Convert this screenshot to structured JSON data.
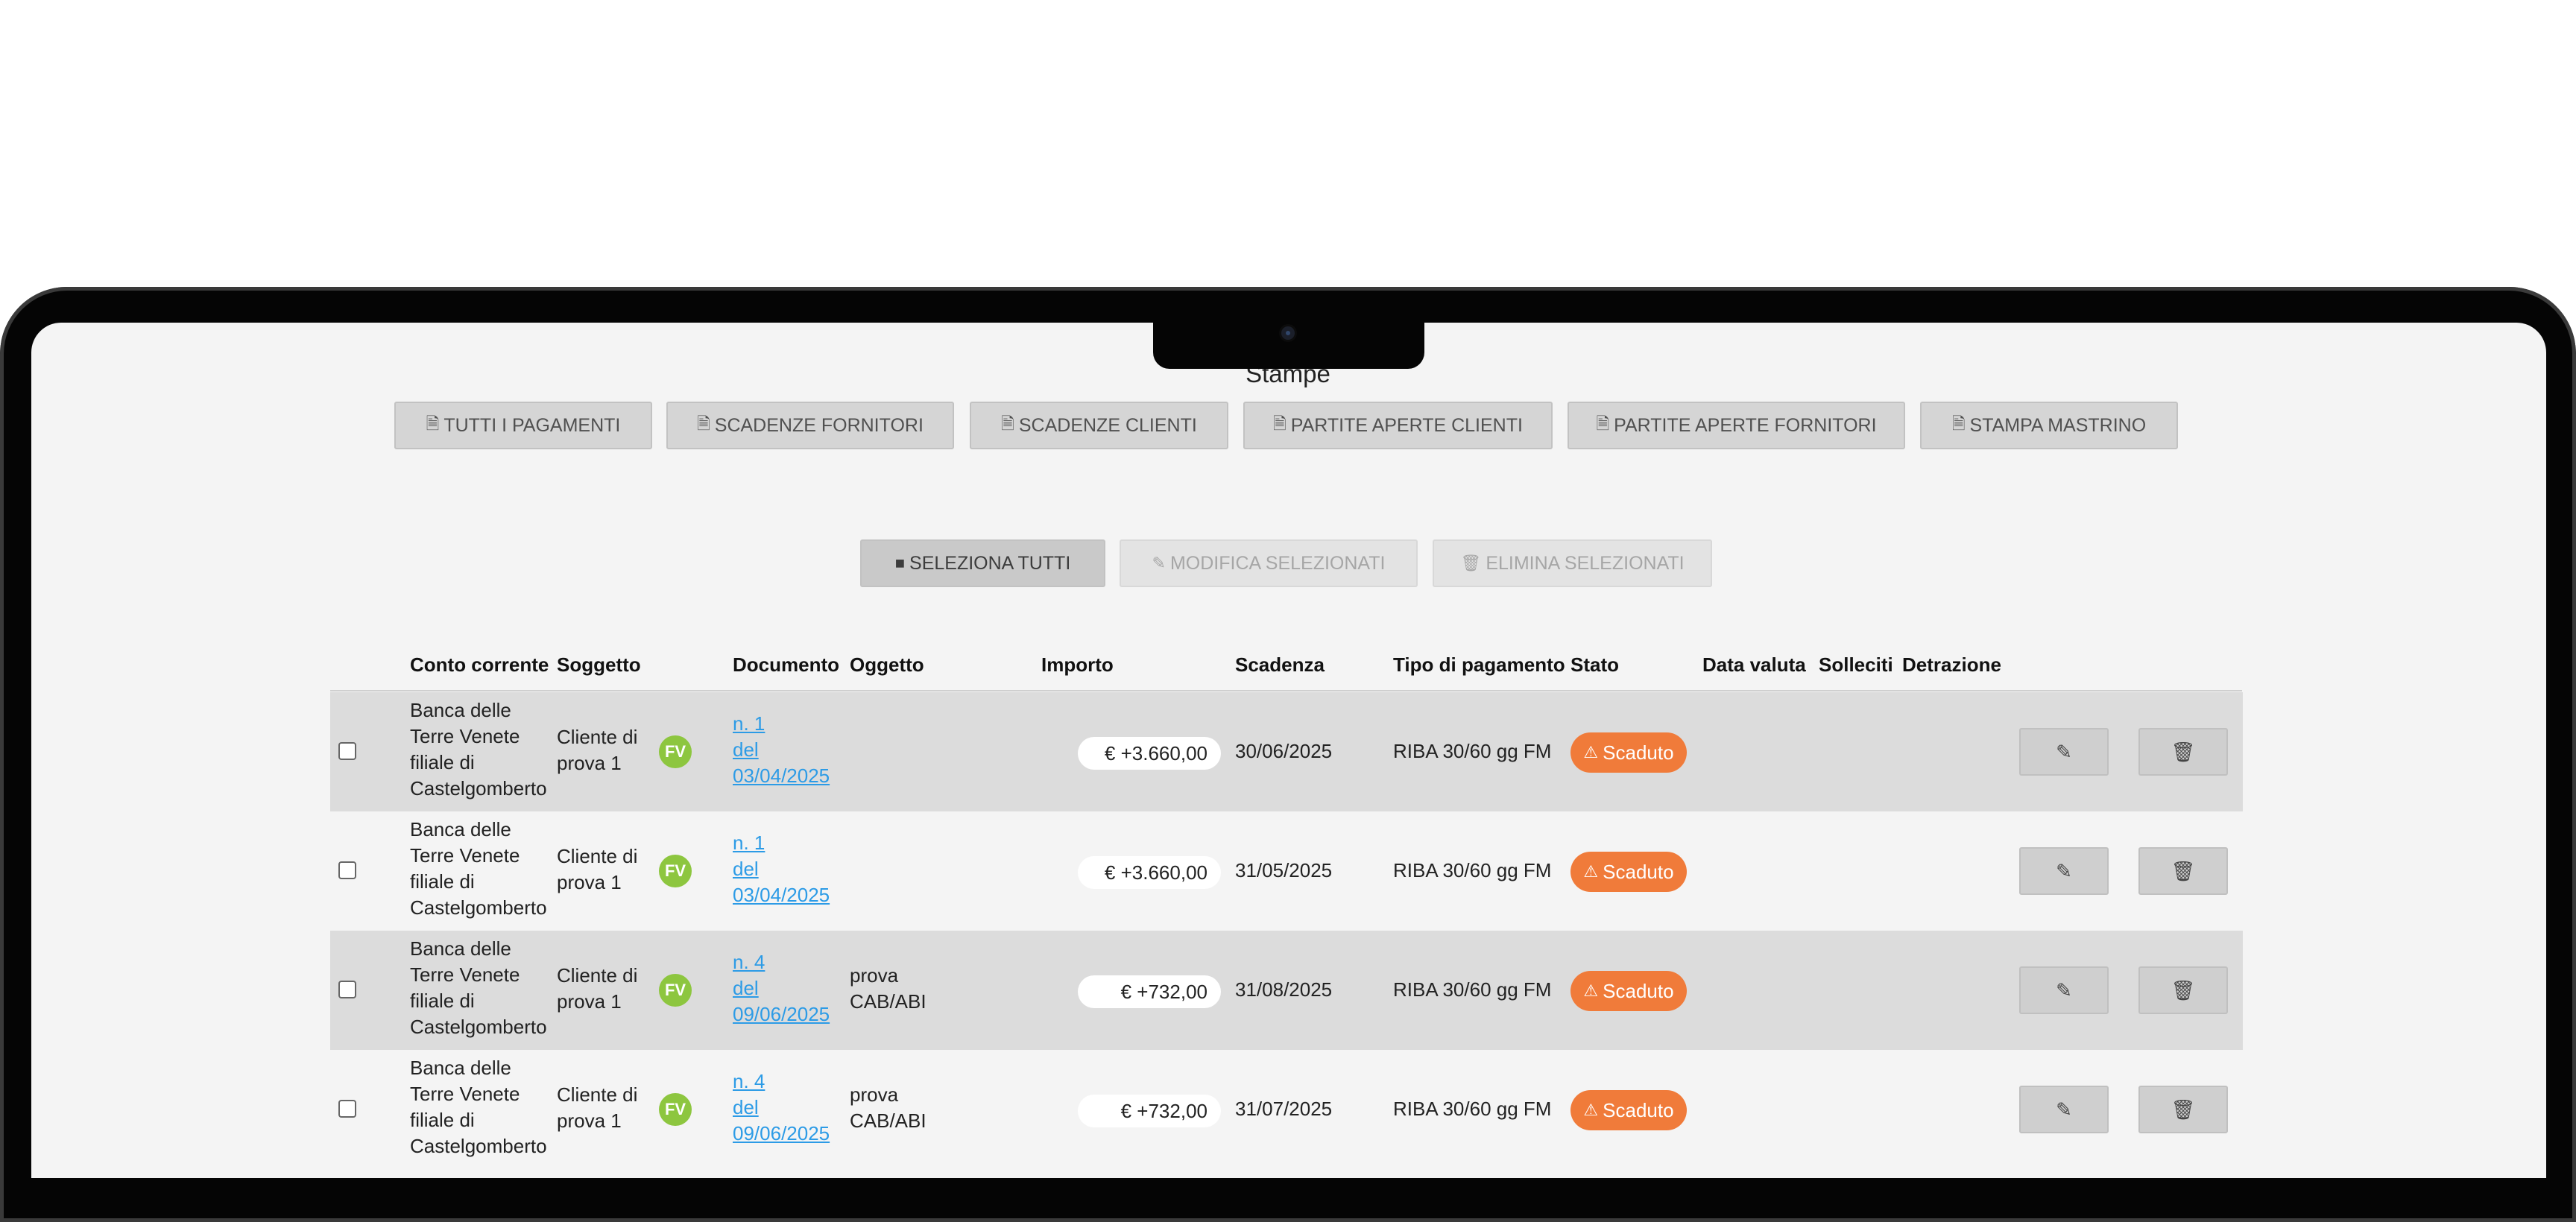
{
  "section_title": "Stampe",
  "print_buttons": [
    {
      "label": "TUTTI I PAGAMENTI"
    },
    {
      "label": "SCADENZE FORNITORI"
    },
    {
      "label": "SCADENZE CLIENTI"
    },
    {
      "label": "PARTITE APERTE CLIENTI"
    },
    {
      "label": "PARTITE APERTE FORNITORI"
    },
    {
      "label": "STAMPA MASTRINO"
    }
  ],
  "bulk_actions": {
    "select_all": "SELEZIONA TUTTI",
    "edit_selected": "MODIFICA SELEZIONATI",
    "delete_selected": "ELIMINA SELEZIONATI"
  },
  "table": {
    "headers": {
      "conto": "Conto corrente",
      "soggetto": "Soggetto",
      "documento": "Documento",
      "oggetto": "Oggetto",
      "importo": "Importo",
      "scadenza": "Scadenza",
      "tipo": "Tipo di pagamento",
      "stato": "Stato",
      "data_valuta": "Data valuta",
      "solleciti": "Solleciti",
      "detrazione": "Detrazione"
    },
    "rows": [
      {
        "conto": [
          "Banca delle",
          "Terre Venete",
          "filiale di",
          "Castelgomberto"
        ],
        "soggetto": [
          "Cliente di",
          "prova 1"
        ],
        "badge": "FV",
        "doc": [
          "n. 1",
          "del",
          "03/04/2025"
        ],
        "oggetto": [
          "",
          ""
        ],
        "importo": "€ +3.660,00",
        "scadenza": "30/06/2025",
        "tipo": "RIBA 30/60 gg FM",
        "stato": "Scaduto"
      },
      {
        "conto": [
          "Banca delle",
          "Terre Venete",
          "filiale di",
          "Castelgomberto"
        ],
        "soggetto": [
          "Cliente di",
          "prova 1"
        ],
        "badge": "FV",
        "doc": [
          "n. 1",
          "del",
          "03/04/2025"
        ],
        "oggetto": [
          "",
          ""
        ],
        "importo": "€ +3.660,00",
        "scadenza": "31/05/2025",
        "tipo": "RIBA 30/60 gg FM",
        "stato": "Scaduto"
      },
      {
        "conto": [
          "Banca delle",
          "Terre Venete",
          "filiale di",
          "Castelgomberto"
        ],
        "soggetto": [
          "Cliente di",
          "prova 1"
        ],
        "badge": "FV",
        "doc": [
          "n. 4",
          "del",
          "09/06/2025"
        ],
        "oggetto": [
          "prova",
          "CAB/ABI"
        ],
        "importo": "€ +732,00",
        "scadenza": "31/08/2025",
        "tipo": "RIBA 30/60 gg FM",
        "stato": "Scaduto"
      },
      {
        "conto": [
          "Banca delle",
          "Terre Venete",
          "filiale di",
          "Castelgomberto"
        ],
        "soggetto": [
          "Cliente di",
          "prova 1"
        ],
        "badge": "FV",
        "doc": [
          "n. 4",
          "del",
          "09/06/2025"
        ],
        "oggetto": [
          "prova",
          "CAB/ABI"
        ],
        "importo": "€ +732,00",
        "scadenza": "31/07/2025",
        "tipo": "RIBA 30/60 gg FM",
        "stato": "Scaduto"
      }
    ]
  }
}
